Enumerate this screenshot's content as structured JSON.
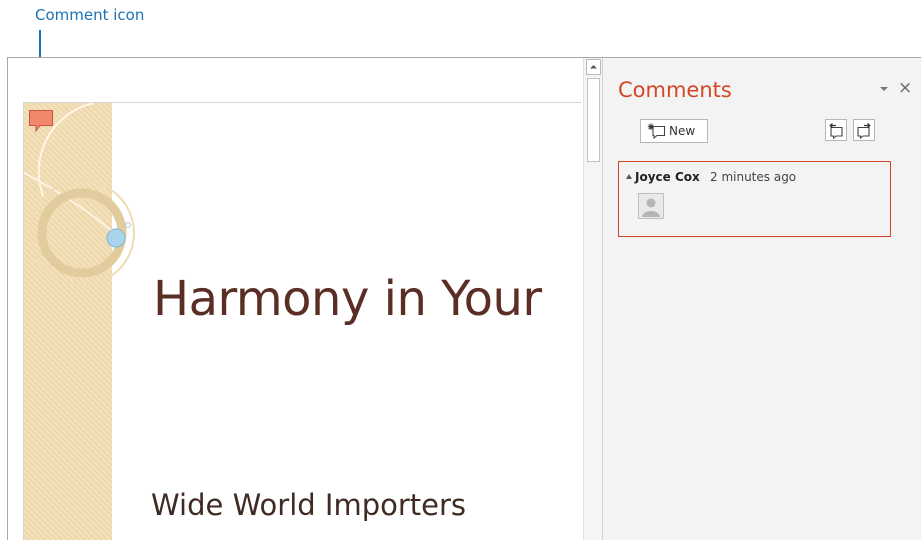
{
  "annotation": {
    "label": "Comment icon"
  },
  "slide": {
    "title": "Harmony in Your",
    "subtitle": "Wide World Importers"
  },
  "comments_pane": {
    "title": "Comments",
    "new_button_label": "New",
    "comments": [
      {
        "author": "Joyce Cox",
        "time": "2 minutes ago"
      }
    ]
  },
  "colors": {
    "accent": "#d24726",
    "callout": "#1a73b8",
    "title_text": "#5a2d25",
    "band": "#f2dcae",
    "comment_marker": "#f2876e"
  }
}
